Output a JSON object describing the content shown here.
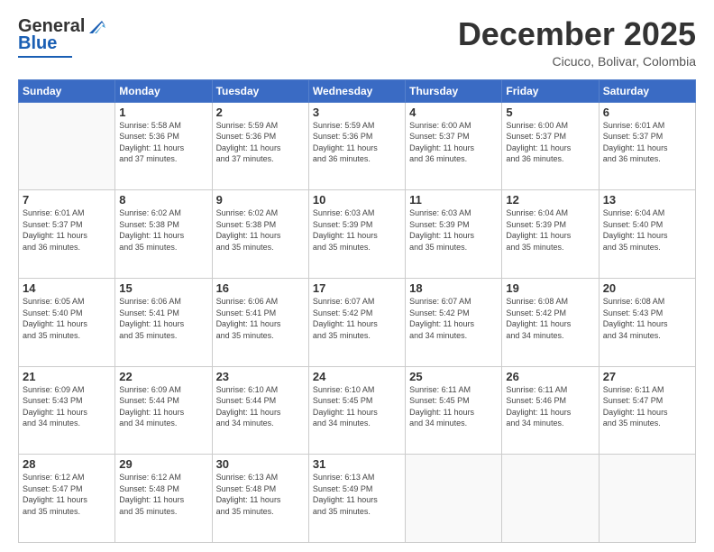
{
  "header": {
    "logo_general": "General",
    "logo_blue": "Blue",
    "month_title": "December 2025",
    "location": "Cicuco, Bolivar, Colombia"
  },
  "days_of_week": [
    "Sunday",
    "Monday",
    "Tuesday",
    "Wednesday",
    "Thursday",
    "Friday",
    "Saturday"
  ],
  "weeks": [
    [
      {
        "day": "",
        "info": ""
      },
      {
        "day": "1",
        "info": "Sunrise: 5:58 AM\nSunset: 5:36 PM\nDaylight: 11 hours\nand 37 minutes."
      },
      {
        "day": "2",
        "info": "Sunrise: 5:59 AM\nSunset: 5:36 PM\nDaylight: 11 hours\nand 37 minutes."
      },
      {
        "day": "3",
        "info": "Sunrise: 5:59 AM\nSunset: 5:36 PM\nDaylight: 11 hours\nand 36 minutes."
      },
      {
        "day": "4",
        "info": "Sunrise: 6:00 AM\nSunset: 5:37 PM\nDaylight: 11 hours\nand 36 minutes."
      },
      {
        "day": "5",
        "info": "Sunrise: 6:00 AM\nSunset: 5:37 PM\nDaylight: 11 hours\nand 36 minutes."
      },
      {
        "day": "6",
        "info": "Sunrise: 6:01 AM\nSunset: 5:37 PM\nDaylight: 11 hours\nand 36 minutes."
      }
    ],
    [
      {
        "day": "7",
        "info": "Sunrise: 6:01 AM\nSunset: 5:37 PM\nDaylight: 11 hours\nand 36 minutes."
      },
      {
        "day": "8",
        "info": "Sunrise: 6:02 AM\nSunset: 5:38 PM\nDaylight: 11 hours\nand 35 minutes."
      },
      {
        "day": "9",
        "info": "Sunrise: 6:02 AM\nSunset: 5:38 PM\nDaylight: 11 hours\nand 35 minutes."
      },
      {
        "day": "10",
        "info": "Sunrise: 6:03 AM\nSunset: 5:39 PM\nDaylight: 11 hours\nand 35 minutes."
      },
      {
        "day": "11",
        "info": "Sunrise: 6:03 AM\nSunset: 5:39 PM\nDaylight: 11 hours\nand 35 minutes."
      },
      {
        "day": "12",
        "info": "Sunrise: 6:04 AM\nSunset: 5:39 PM\nDaylight: 11 hours\nand 35 minutes."
      },
      {
        "day": "13",
        "info": "Sunrise: 6:04 AM\nSunset: 5:40 PM\nDaylight: 11 hours\nand 35 minutes."
      }
    ],
    [
      {
        "day": "14",
        "info": "Sunrise: 6:05 AM\nSunset: 5:40 PM\nDaylight: 11 hours\nand 35 minutes."
      },
      {
        "day": "15",
        "info": "Sunrise: 6:06 AM\nSunset: 5:41 PM\nDaylight: 11 hours\nand 35 minutes."
      },
      {
        "day": "16",
        "info": "Sunrise: 6:06 AM\nSunset: 5:41 PM\nDaylight: 11 hours\nand 35 minutes."
      },
      {
        "day": "17",
        "info": "Sunrise: 6:07 AM\nSunset: 5:42 PM\nDaylight: 11 hours\nand 35 minutes."
      },
      {
        "day": "18",
        "info": "Sunrise: 6:07 AM\nSunset: 5:42 PM\nDaylight: 11 hours\nand 34 minutes."
      },
      {
        "day": "19",
        "info": "Sunrise: 6:08 AM\nSunset: 5:42 PM\nDaylight: 11 hours\nand 34 minutes."
      },
      {
        "day": "20",
        "info": "Sunrise: 6:08 AM\nSunset: 5:43 PM\nDaylight: 11 hours\nand 34 minutes."
      }
    ],
    [
      {
        "day": "21",
        "info": "Sunrise: 6:09 AM\nSunset: 5:43 PM\nDaylight: 11 hours\nand 34 minutes."
      },
      {
        "day": "22",
        "info": "Sunrise: 6:09 AM\nSunset: 5:44 PM\nDaylight: 11 hours\nand 34 minutes."
      },
      {
        "day": "23",
        "info": "Sunrise: 6:10 AM\nSunset: 5:44 PM\nDaylight: 11 hours\nand 34 minutes."
      },
      {
        "day": "24",
        "info": "Sunrise: 6:10 AM\nSunset: 5:45 PM\nDaylight: 11 hours\nand 34 minutes."
      },
      {
        "day": "25",
        "info": "Sunrise: 6:11 AM\nSunset: 5:45 PM\nDaylight: 11 hours\nand 34 minutes."
      },
      {
        "day": "26",
        "info": "Sunrise: 6:11 AM\nSunset: 5:46 PM\nDaylight: 11 hours\nand 34 minutes."
      },
      {
        "day": "27",
        "info": "Sunrise: 6:11 AM\nSunset: 5:47 PM\nDaylight: 11 hours\nand 35 minutes."
      }
    ],
    [
      {
        "day": "28",
        "info": "Sunrise: 6:12 AM\nSunset: 5:47 PM\nDaylight: 11 hours\nand 35 minutes."
      },
      {
        "day": "29",
        "info": "Sunrise: 6:12 AM\nSunset: 5:48 PM\nDaylight: 11 hours\nand 35 minutes."
      },
      {
        "day": "30",
        "info": "Sunrise: 6:13 AM\nSunset: 5:48 PM\nDaylight: 11 hours\nand 35 minutes."
      },
      {
        "day": "31",
        "info": "Sunrise: 6:13 AM\nSunset: 5:49 PM\nDaylight: 11 hours\nand 35 minutes."
      },
      {
        "day": "",
        "info": ""
      },
      {
        "day": "",
        "info": ""
      },
      {
        "day": "",
        "info": ""
      }
    ]
  ]
}
